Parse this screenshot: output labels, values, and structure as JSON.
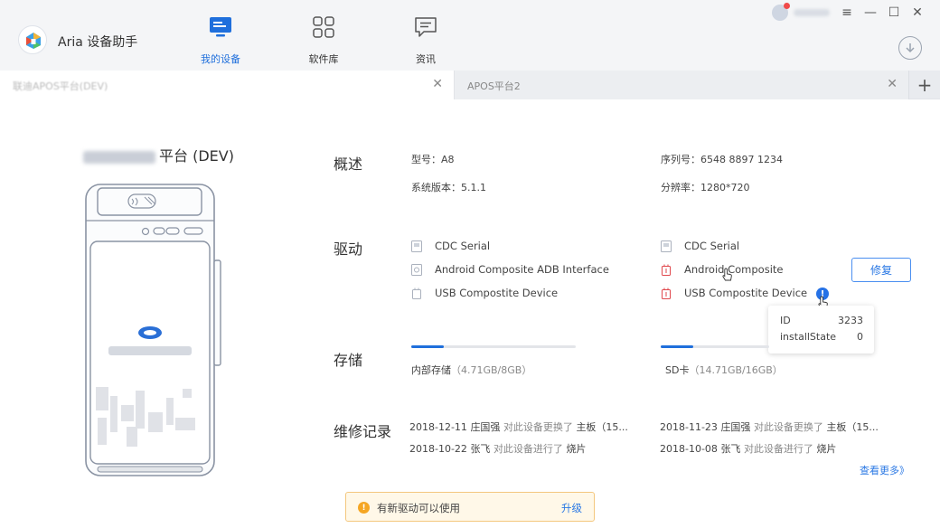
{
  "app": {
    "name": "Aria 设备助手"
  },
  "nav": [
    {
      "label": "我的设备",
      "active": true
    },
    {
      "label": "软件库",
      "active": false
    },
    {
      "label": "资讯",
      "active": false
    }
  ],
  "tabs": {
    "active_label": "联迪APOS平台(DEV)",
    "inactive_label": "APOS平台2",
    "close_glyph": "✕",
    "add_glyph": "+"
  },
  "device": {
    "title_suffix": "平台 (DEV)"
  },
  "overview": {
    "title": "概述",
    "model": "型号：A8",
    "os_version": "系统版本：5.1.1",
    "serial": "序列号：6548 8897 1234",
    "resolution": "分辨率：1280*720"
  },
  "drivers": {
    "title": "驱动",
    "left": [
      {
        "name": "CDC Serial",
        "status": "ok"
      },
      {
        "name": "Android Composite ADB Interface",
        "status": "ok"
      },
      {
        "name": "USB Compostite Device",
        "status": "ok"
      }
    ],
    "right": [
      {
        "name": "CDC Serial",
        "status": "ok"
      },
      {
        "name": "Android Composite",
        "status": "error"
      },
      {
        "name": "USB Compostite Device",
        "status": "error"
      }
    ],
    "repair_label": "修复",
    "info_glyph": "!",
    "tooltip": {
      "rows": [
        {
          "key": "ID",
          "value": "3233"
        },
        {
          "key": "installState",
          "value": "0"
        }
      ]
    }
  },
  "storage": {
    "title": "存储",
    "internal": {
      "label": "内部存储",
      "detail": "（4.71GB/8GB）",
      "fraction": 0.2
    },
    "sd": {
      "label": "SD卡",
      "detail": "（14.71GB/16GB）",
      "fraction": 0.3
    }
  },
  "records": {
    "title": "维修记录",
    "left": [
      {
        "date": "2018-12-11",
        "person": "庄国强",
        "action": "对此设备更换了",
        "item": "主板（15..."
      },
      {
        "date": "2018-10-22",
        "person": "张飞",
        "action": "对此设备进行了",
        "item": "烧片"
      }
    ],
    "right": [
      {
        "date": "2018-11-23",
        "person": "庄国强",
        "action": "对此设备更换了",
        "item": "主板（15..."
      },
      {
        "date": "2018-10-08",
        "person": "张飞",
        "action": "对此设备进行了",
        "item": "烧片"
      }
    ],
    "more_label": "查看更多》"
  },
  "notice": {
    "text": "有新驱动可以使用",
    "action": "升级",
    "glyph": "!"
  },
  "window": {
    "menu_glyph": "≡",
    "min_glyph": "—",
    "max_glyph": "☐",
    "close_glyph": "✕"
  },
  "colors": {
    "accent": "#1f6fdc",
    "error": "#e0474c",
    "warning": "#f5a623"
  }
}
